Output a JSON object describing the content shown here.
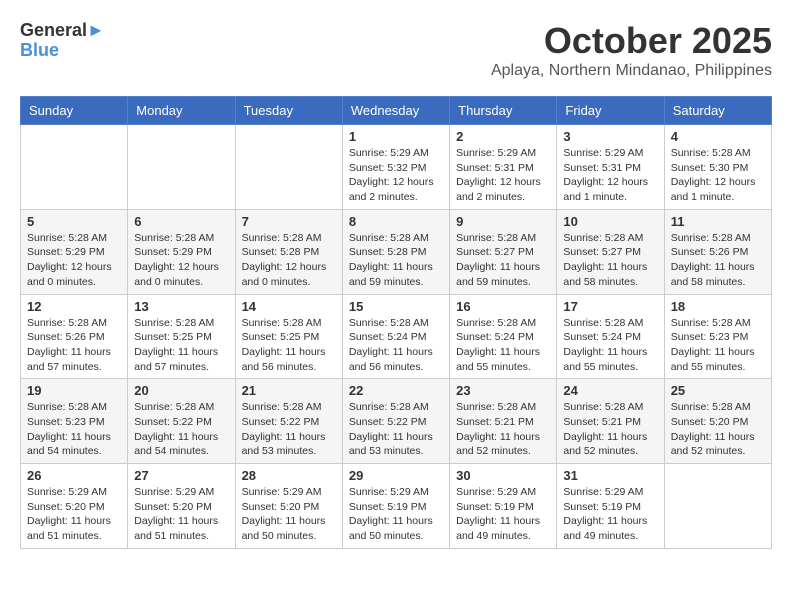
{
  "header": {
    "logo_line1": "General",
    "logo_line2": "Blue",
    "month": "October 2025",
    "location": "Aplaya, Northern Mindanao, Philippines"
  },
  "weekdays": [
    "Sunday",
    "Monday",
    "Tuesday",
    "Wednesday",
    "Thursday",
    "Friday",
    "Saturday"
  ],
  "weeks": [
    [
      {
        "day": "",
        "sunrise": "",
        "sunset": "",
        "daylight": ""
      },
      {
        "day": "",
        "sunrise": "",
        "sunset": "",
        "daylight": ""
      },
      {
        "day": "",
        "sunrise": "",
        "sunset": "",
        "daylight": ""
      },
      {
        "day": "1",
        "sunrise": "Sunrise: 5:29 AM",
        "sunset": "Sunset: 5:32 PM",
        "daylight": "Daylight: 12 hours and 2 minutes."
      },
      {
        "day": "2",
        "sunrise": "Sunrise: 5:29 AM",
        "sunset": "Sunset: 5:31 PM",
        "daylight": "Daylight: 12 hours and 2 minutes."
      },
      {
        "day": "3",
        "sunrise": "Sunrise: 5:29 AM",
        "sunset": "Sunset: 5:31 PM",
        "daylight": "Daylight: 12 hours and 1 minute."
      },
      {
        "day": "4",
        "sunrise": "Sunrise: 5:28 AM",
        "sunset": "Sunset: 5:30 PM",
        "daylight": "Daylight: 12 hours and 1 minute."
      }
    ],
    [
      {
        "day": "5",
        "sunrise": "Sunrise: 5:28 AM",
        "sunset": "Sunset: 5:29 PM",
        "daylight": "Daylight: 12 hours and 0 minutes."
      },
      {
        "day": "6",
        "sunrise": "Sunrise: 5:28 AM",
        "sunset": "Sunset: 5:29 PM",
        "daylight": "Daylight: 12 hours and 0 minutes."
      },
      {
        "day": "7",
        "sunrise": "Sunrise: 5:28 AM",
        "sunset": "Sunset: 5:28 PM",
        "daylight": "Daylight: 12 hours and 0 minutes."
      },
      {
        "day": "8",
        "sunrise": "Sunrise: 5:28 AM",
        "sunset": "Sunset: 5:28 PM",
        "daylight": "Daylight: 11 hours and 59 minutes."
      },
      {
        "day": "9",
        "sunrise": "Sunrise: 5:28 AM",
        "sunset": "Sunset: 5:27 PM",
        "daylight": "Daylight: 11 hours and 59 minutes."
      },
      {
        "day": "10",
        "sunrise": "Sunrise: 5:28 AM",
        "sunset": "Sunset: 5:27 PM",
        "daylight": "Daylight: 11 hours and 58 minutes."
      },
      {
        "day": "11",
        "sunrise": "Sunrise: 5:28 AM",
        "sunset": "Sunset: 5:26 PM",
        "daylight": "Daylight: 11 hours and 58 minutes."
      }
    ],
    [
      {
        "day": "12",
        "sunrise": "Sunrise: 5:28 AM",
        "sunset": "Sunset: 5:26 PM",
        "daylight": "Daylight: 11 hours and 57 minutes."
      },
      {
        "day": "13",
        "sunrise": "Sunrise: 5:28 AM",
        "sunset": "Sunset: 5:25 PM",
        "daylight": "Daylight: 11 hours and 57 minutes."
      },
      {
        "day": "14",
        "sunrise": "Sunrise: 5:28 AM",
        "sunset": "Sunset: 5:25 PM",
        "daylight": "Daylight: 11 hours and 56 minutes."
      },
      {
        "day": "15",
        "sunrise": "Sunrise: 5:28 AM",
        "sunset": "Sunset: 5:24 PM",
        "daylight": "Daylight: 11 hours and 56 minutes."
      },
      {
        "day": "16",
        "sunrise": "Sunrise: 5:28 AM",
        "sunset": "Sunset: 5:24 PM",
        "daylight": "Daylight: 11 hours and 55 minutes."
      },
      {
        "day": "17",
        "sunrise": "Sunrise: 5:28 AM",
        "sunset": "Sunset: 5:24 PM",
        "daylight": "Daylight: 11 hours and 55 minutes."
      },
      {
        "day": "18",
        "sunrise": "Sunrise: 5:28 AM",
        "sunset": "Sunset: 5:23 PM",
        "daylight": "Daylight: 11 hours and 55 minutes."
      }
    ],
    [
      {
        "day": "19",
        "sunrise": "Sunrise: 5:28 AM",
        "sunset": "Sunset: 5:23 PM",
        "daylight": "Daylight: 11 hours and 54 minutes."
      },
      {
        "day": "20",
        "sunrise": "Sunrise: 5:28 AM",
        "sunset": "Sunset: 5:22 PM",
        "daylight": "Daylight: 11 hours and 54 minutes."
      },
      {
        "day": "21",
        "sunrise": "Sunrise: 5:28 AM",
        "sunset": "Sunset: 5:22 PM",
        "daylight": "Daylight: 11 hours and 53 minutes."
      },
      {
        "day": "22",
        "sunrise": "Sunrise: 5:28 AM",
        "sunset": "Sunset: 5:22 PM",
        "daylight": "Daylight: 11 hours and 53 minutes."
      },
      {
        "day": "23",
        "sunrise": "Sunrise: 5:28 AM",
        "sunset": "Sunset: 5:21 PM",
        "daylight": "Daylight: 11 hours and 52 minutes."
      },
      {
        "day": "24",
        "sunrise": "Sunrise: 5:28 AM",
        "sunset": "Sunset: 5:21 PM",
        "daylight": "Daylight: 11 hours and 52 minutes."
      },
      {
        "day": "25",
        "sunrise": "Sunrise: 5:28 AM",
        "sunset": "Sunset: 5:20 PM",
        "daylight": "Daylight: 11 hours and 52 minutes."
      }
    ],
    [
      {
        "day": "26",
        "sunrise": "Sunrise: 5:29 AM",
        "sunset": "Sunset: 5:20 PM",
        "daylight": "Daylight: 11 hours and 51 minutes."
      },
      {
        "day": "27",
        "sunrise": "Sunrise: 5:29 AM",
        "sunset": "Sunset: 5:20 PM",
        "daylight": "Daylight: 11 hours and 51 minutes."
      },
      {
        "day": "28",
        "sunrise": "Sunrise: 5:29 AM",
        "sunset": "Sunset: 5:20 PM",
        "daylight": "Daylight: 11 hours and 50 minutes."
      },
      {
        "day": "29",
        "sunrise": "Sunrise: 5:29 AM",
        "sunset": "Sunset: 5:19 PM",
        "daylight": "Daylight: 11 hours and 50 minutes."
      },
      {
        "day": "30",
        "sunrise": "Sunrise: 5:29 AM",
        "sunset": "Sunset: 5:19 PM",
        "daylight": "Daylight: 11 hours and 49 minutes."
      },
      {
        "day": "31",
        "sunrise": "Sunrise: 5:29 AM",
        "sunset": "Sunset: 5:19 PM",
        "daylight": "Daylight: 11 hours and 49 minutes."
      },
      {
        "day": "",
        "sunrise": "",
        "sunset": "",
        "daylight": ""
      }
    ]
  ]
}
